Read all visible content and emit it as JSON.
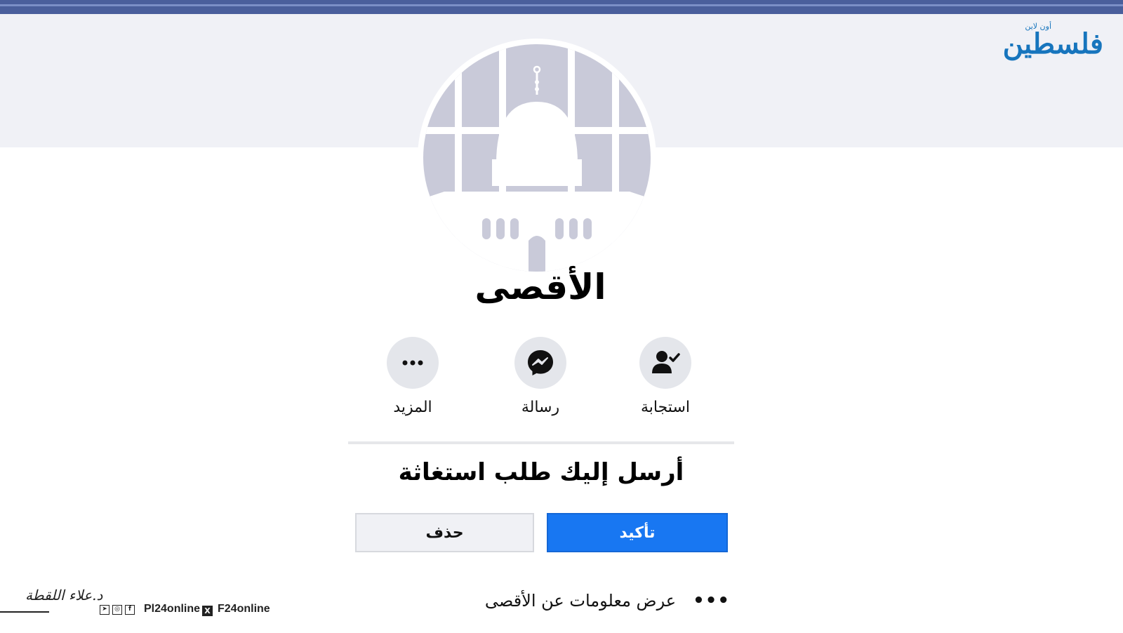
{
  "profile": {
    "name": "الأقصى"
  },
  "actions": [
    {
      "label": "استجابة",
      "icon": "person-check-icon"
    },
    {
      "label": "رسالة",
      "icon": "messenger-icon"
    },
    {
      "label": "المزيد",
      "icon": "more-dots-icon"
    }
  ],
  "request": {
    "text": "أرسل إليك طلب استغاثة",
    "confirm_label": "تأكيد",
    "delete_label": "حذف"
  },
  "info": {
    "dots": "•••",
    "text": "عرض معلومات عن الأقصى"
  },
  "logo": {
    "main": "فلسطين",
    "sub": "أون لاين"
  },
  "footer": {
    "signature": "د.علاء اللقطة",
    "handle_1": "Pl24online",
    "handle_2": "F24online"
  },
  "colors": {
    "accent": "#1877f2",
    "top_bar": "#4a5f9c",
    "cover": "#f0f1f6",
    "avatar_fill": "#c9cad9"
  }
}
